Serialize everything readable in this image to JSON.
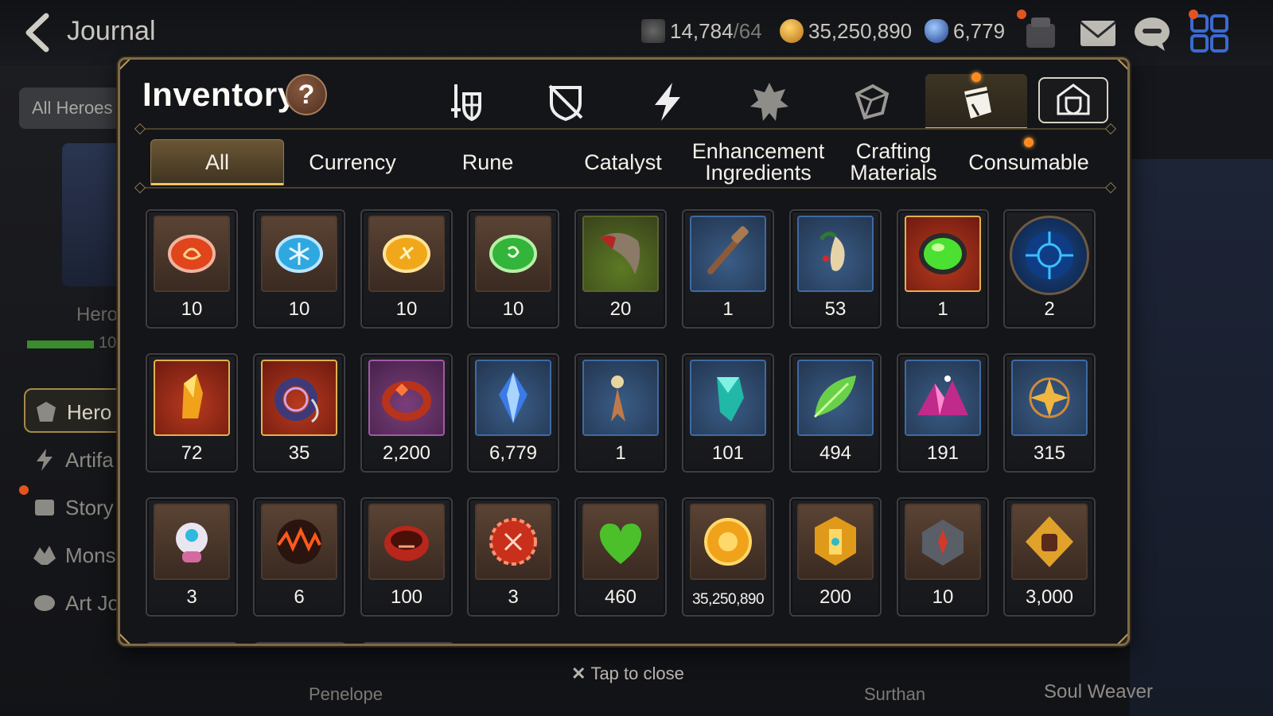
{
  "header": {
    "title": "Journal",
    "stamina": "14,784",
    "stamina_max": "/64",
    "gold": "35,250,890",
    "skystone": "6,779"
  },
  "sidebar": {
    "filter_label": "All Heroes",
    "sub_label": "Hero",
    "progress_text": "10",
    "items": [
      {
        "label": "Hero",
        "icon": "hero-icon"
      },
      {
        "label": "Artifa",
        "icon": "artifact-icon"
      },
      {
        "label": "Story",
        "icon": "story-icon"
      },
      {
        "label": "Mons",
        "icon": "monster-icon"
      },
      {
        "label": "Art Jo",
        "icon": "art-icon"
      }
    ]
  },
  "bottom": {
    "name_left": "Penelope",
    "name_right": "Surthan",
    "section_right": "Soul Weaver",
    "tap_close": "Tap to close"
  },
  "inventory": {
    "title": "Inventory",
    "help": "?",
    "category_icons": [
      "equipment-icon",
      "no-equipment-icon",
      "artifact-bolt-icon",
      "hero-crest-icon",
      "dice-icon",
      "bag-icon",
      "storage-icon"
    ],
    "active_category": 5,
    "tabs": [
      "All",
      "Currency",
      "Rune",
      "Catalyst",
      "Enhancement Ingredients",
      "Crafting Materials",
      "Consumable"
    ],
    "active_tab": 0,
    "items": [
      {
        "qty": "10",
        "icon": "fire-rune-icon",
        "frame": "brown"
      },
      {
        "qty": "10",
        "icon": "ice-rune-icon",
        "frame": "brown"
      },
      {
        "qty": "10",
        "icon": "earth-rune-icon",
        "frame": "brown"
      },
      {
        "qty": "10",
        "icon": "nature-rune-icon",
        "frame": "brown"
      },
      {
        "qty": "20",
        "icon": "claw-icon",
        "frame": "green"
      },
      {
        "qty": "1",
        "icon": "hammer-icon",
        "frame": "blue"
      },
      {
        "qty": "53",
        "icon": "ginseng-icon",
        "frame": "blue"
      },
      {
        "qty": "1",
        "icon": "green-orb-icon",
        "frame": "red"
      },
      {
        "qty": "2",
        "icon": "cyber-orb-icon",
        "frame": "round"
      },
      {
        "qty": "72",
        "icon": "golden-crystal-icon",
        "frame": "red"
      },
      {
        "qty": "35",
        "icon": "leash-icon",
        "frame": "red"
      },
      {
        "qty": "2,200",
        "icon": "ring-icon",
        "frame": "purple"
      },
      {
        "qty": "6,779",
        "icon": "skystone-icon",
        "frame": "blue"
      },
      {
        "qty": "1",
        "icon": "dagger-charm-icon",
        "frame": "blue"
      },
      {
        "qty": "101",
        "icon": "emerald-shard-icon",
        "frame": "blue"
      },
      {
        "qty": "494",
        "icon": "leaf-icon",
        "frame": "blue"
      },
      {
        "qty": "191",
        "icon": "crystal-pile-icon",
        "frame": "blue"
      },
      {
        "qty": "315",
        "icon": "star-charm-icon",
        "frame": "blue"
      },
      {
        "qty": "3",
        "icon": "robot-icon",
        "frame": "brown"
      },
      {
        "qty": "6",
        "icon": "lava-orb-icon",
        "frame": "brown"
      },
      {
        "qty": "100",
        "icon": "bracelet-icon",
        "frame": "brown"
      },
      {
        "qty": "3",
        "icon": "badge-icon",
        "frame": "brown"
      },
      {
        "qty": "460",
        "icon": "heart-icon",
        "frame": "brown"
      },
      {
        "qty": "35,250,890",
        "icon": "gold-coin-icon",
        "frame": "brown"
      },
      {
        "qty": "200",
        "icon": "gold-emblem-icon",
        "frame": "brown"
      },
      {
        "qty": "10",
        "icon": "stone-compass-icon",
        "frame": "brown"
      },
      {
        "qty": "3,000",
        "icon": "fist-emblem-icon",
        "frame": "brown"
      }
    ]
  },
  "colors": {
    "accent": "#f0c45c",
    "panel_border": "#7d6a45",
    "notification": "#ff8a1f"
  }
}
